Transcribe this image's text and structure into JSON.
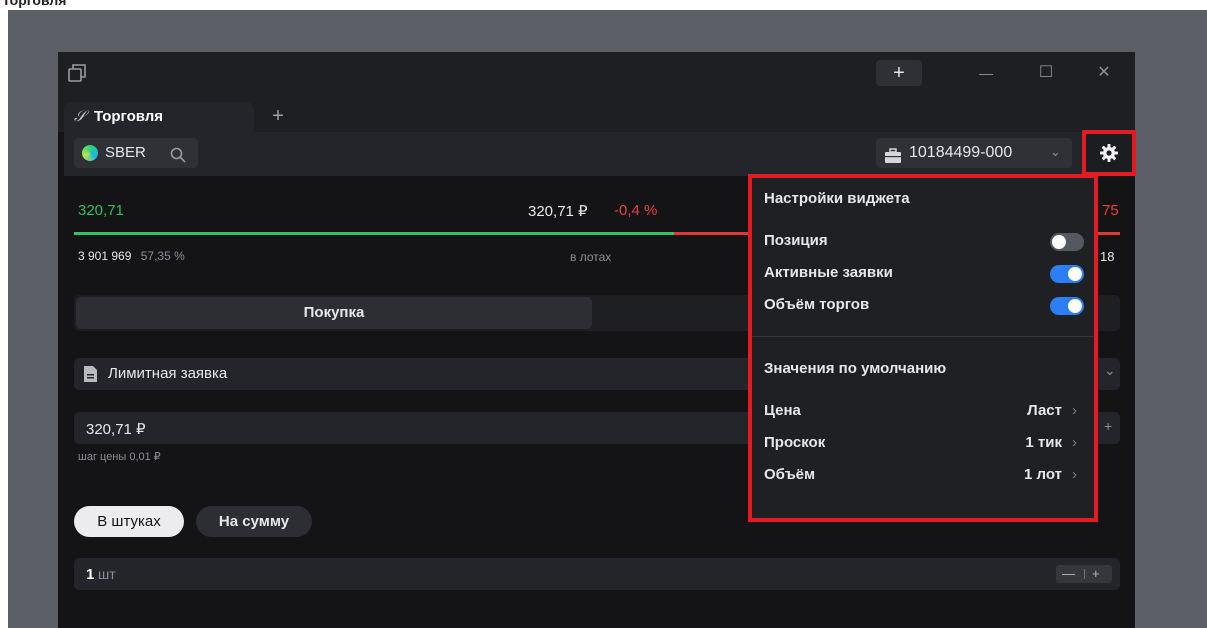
{
  "top_cut_text": "Торговля",
  "titlebar": {
    "new_window_label": "+",
    "minimize_label": "—",
    "maximize_label": "☐",
    "close_label": "✕"
  },
  "tabs": {
    "active_label": "Торговля",
    "add_label": "+"
  },
  "instrument": {
    "ticker": "SBER",
    "account": "10184499-000"
  },
  "quotes": {
    "bid": "320,71",
    "last": "320,71 ₽",
    "change": "-0,4 %",
    "ask_partial": "75",
    "buy_volume": "3 901 969",
    "buy_percent": "57,35 %",
    "lots_label": "в лотах",
    "sell_volume_partial": "18",
    "buy_share": 0.5735
  },
  "order": {
    "buy_label": "Покупка",
    "type_label": "Лимитная заявка",
    "price_value": "320,71 ₽",
    "price_step": "шаг цены 0,01 ₽",
    "mode_pieces": "В штуках",
    "mode_sum": "На сумму",
    "qty_number": "1",
    "qty_unit": "шт",
    "minus_label": "—",
    "plus_label": "+"
  },
  "settings": {
    "title": "Настройки виджета",
    "toggles": [
      {
        "label": "Позиция",
        "on": false
      },
      {
        "label": "Активные заявки",
        "on": true
      },
      {
        "label": "Объём торгов",
        "on": true
      }
    ],
    "defaults_title": "Значения по умолчанию",
    "defaults": [
      {
        "label": "Цена",
        "value": "Ласт"
      },
      {
        "label": "Проскок",
        "value": "1 тик"
      },
      {
        "label": "Объём",
        "value": "1 лот"
      }
    ]
  },
  "colors": {
    "accent_red": "#e31b23",
    "toggle_on": "#2b7ef4",
    "up": "#2fbf5b",
    "down": "#e8423a"
  },
  "icons": [
    "window-icon",
    "link-icon",
    "sber-logo-icon",
    "search-icon",
    "briefcase-icon",
    "chevron-down-icon",
    "gear-icon",
    "document-icon",
    "chevron-right-icon"
  ]
}
